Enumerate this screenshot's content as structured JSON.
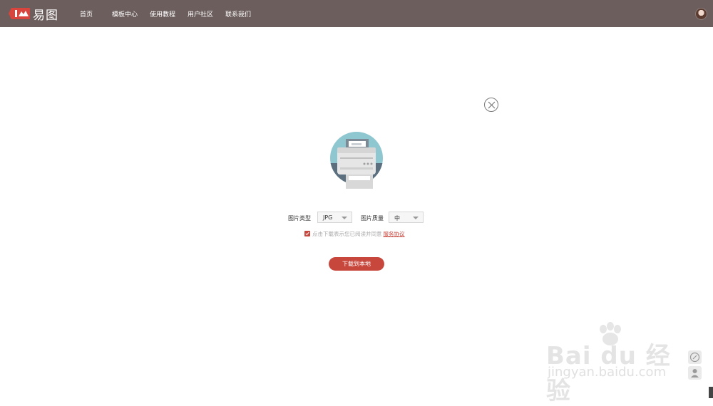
{
  "header": {
    "logo_text": "易图",
    "nav": [
      "首页",
      "模板中心",
      "使用教程",
      "用户社区",
      "联系我们"
    ]
  },
  "download_dialog": {
    "image_type_label": "图片类型",
    "image_type_value": "JPG",
    "image_quality_label": "图片质量",
    "image_quality_value": "中",
    "agreement_text": "点击下载表示您已阅读并同意",
    "agreement_link": "服务协议",
    "agreement_checked": true,
    "download_button": "下载到本地"
  },
  "watermark": {
    "brand": "Bai du 经验",
    "url": "jingyan.baidu.com"
  },
  "icons": {
    "close": "close-icon",
    "printer": "printer-illustration",
    "feedback": "edit-icon",
    "user": "user-icon"
  },
  "colors": {
    "header_bg": "#6b5e5c",
    "accent": "#c8473d",
    "printer_circle": "#8fc7d1"
  }
}
